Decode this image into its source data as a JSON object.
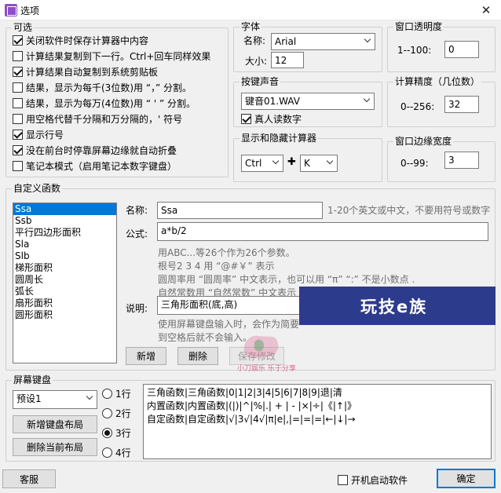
{
  "window": {
    "title": "选项",
    "close_glyph": "✕"
  },
  "options": {
    "legend": "可选",
    "items": [
      {
        "label": "关闭软件时保存计算器中内容",
        "checked": true
      },
      {
        "label": "计算结果复制到下一行。Ctrl+回车同样效果",
        "checked": false
      },
      {
        "label": "计算结果自动复制到系统剪贴板",
        "checked": true
      },
      {
        "label": "结果，显示为每千(3位数)用 “，” 分割。",
        "checked": false
      },
      {
        "label": "结果，显示为每万(4位数)用 “ ' ” 分割。",
        "checked": false
      },
      {
        "label": "用空格代替千分隔和万分隔的，' 符号",
        "checked": false
      },
      {
        "label": "显示行号",
        "checked": true
      },
      {
        "label": "没在前台时停靠屏幕边缘就自动折叠",
        "checked": true
      },
      {
        "label": "笔记本模式（启用笔记本数字键盘）",
        "checked": false
      }
    ]
  },
  "font": {
    "legend": "字体",
    "name_label": "名称:",
    "name_value": "Arial",
    "size_label": "大小:",
    "size_value": "12"
  },
  "opacity": {
    "legend": "窗口透明度",
    "range_label": "1--100:",
    "value": "0"
  },
  "sound": {
    "legend": "按键声音",
    "selected": "键音01.WAV",
    "voice_label": "真人读数字",
    "voice_checked": true
  },
  "precision": {
    "legend": "计算精度（几位数）",
    "range_label": "0--256:",
    "value": "32"
  },
  "hotkey": {
    "legend": "显示和隐藏计算器",
    "modifier": "Ctrl",
    "plus": "✚",
    "key": "K"
  },
  "border": {
    "legend": "窗口边缘宽度",
    "range_label": "0--99:",
    "value": "3"
  },
  "functions": {
    "legend": "自定义函数",
    "list": [
      "Ssa",
      "Ssb",
      "平行四边形面积",
      "Sla",
      "Slb",
      "梯形面积",
      "圆周长",
      "弧长",
      "扇形面积",
      "圆形面积"
    ],
    "selected_index": 0,
    "name_label": "名称:",
    "name_value": "Ssa",
    "name_hint": "1-20个英文或中文，不要用符号或数字",
    "formula_label": "公式:",
    "formula_value": "a*b/2",
    "formula_hints": [
      "用ABC...等26个作为26个参数。",
      "根号2 3 4 用 “@#￥” 表示",
      "圆周率用 “圆周率” 中文表示，也可以用 “π” “:” 不是小数点 .",
      "自然常数用 “自然常数” 中文表示"
    ],
    "desc_label": "说明:",
    "desc_value": "三角形面积(底,高)",
    "desc_hints": [
      "使用屏幕键盘输入时，会作为简要",
      "到空格后就不会输入。"
    ],
    "add_button": "新增",
    "delete_button": "删除",
    "save_button": "保存修改"
  },
  "keyboard": {
    "legend": "屏幕键盘",
    "preset": "预设1",
    "new_layout_button": "新增键盘布局",
    "delete_layout_button": "删除当前布局",
    "rows_options": [
      "1行",
      "2行",
      "3行",
      "4行"
    ],
    "rows_selected": 2,
    "content": "三角函数|三角函数|0|1|2|3|4|5|6|7|8|9|退|清\n内置函数|内置函数|(|)|^|%|.| + | - |×|÷|《|↑|》\n自定函数|自定函数|√|3√|4√|π|e|,|=|=|=|←|↓|→"
  },
  "footer": {
    "service_button": "客服",
    "autostart_label": "开机启动软件",
    "autostart_checked": false,
    "ok_button": "确定"
  },
  "watermark": {
    "text": "玩技e族",
    "sub": "小刀娱乐  乐于分享"
  }
}
